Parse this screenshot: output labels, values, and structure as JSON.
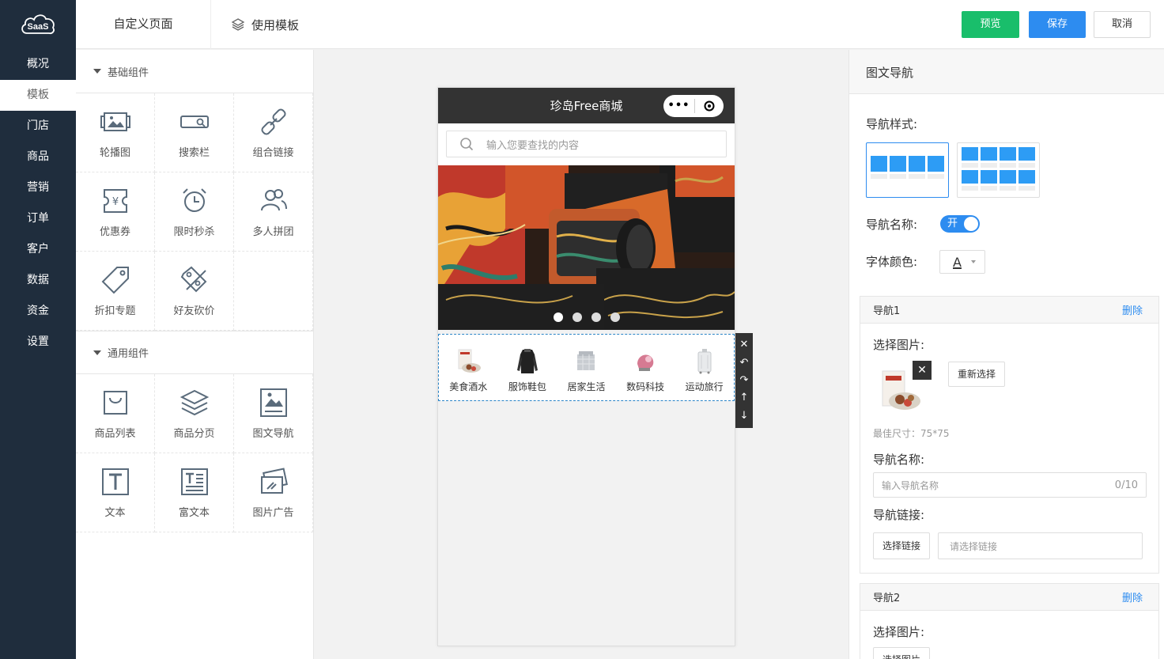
{
  "app": {
    "logo_text": "SaaS"
  },
  "leftnav": {
    "items": [
      {
        "label": "概况"
      },
      {
        "label": "模板"
      },
      {
        "label": "门店"
      },
      {
        "label": "商品"
      },
      {
        "label": "营销"
      },
      {
        "label": "订单"
      },
      {
        "label": "客户"
      },
      {
        "label": "数据"
      },
      {
        "label": "资金"
      },
      {
        "label": "设置"
      }
    ],
    "active_index": 1
  },
  "header": {
    "tab_custom": "自定义页面",
    "tab_template": "使用模板",
    "preview_label": "预览",
    "save_label": "保存",
    "cancel_label": "取消"
  },
  "components": {
    "basic_title": "基础组件",
    "basic": [
      {
        "label": "轮播图",
        "icon": "carousel-icon"
      },
      {
        "label": "搜索栏",
        "icon": "search-bar-icon"
      },
      {
        "label": "组合链接",
        "icon": "link-icon"
      },
      {
        "label": "优惠券",
        "icon": "coupon-icon"
      },
      {
        "label": "限时秒杀",
        "icon": "alarm-clock-icon"
      },
      {
        "label": "多人拼团",
        "icon": "group-users-icon"
      },
      {
        "label": "折扣专题",
        "icon": "price-tag-icon"
      },
      {
        "label": "好友砍价",
        "icon": "discount-icon"
      }
    ],
    "common_title": "通用组件",
    "common": [
      {
        "label": "商品列表",
        "icon": "shopping-bag-icon"
      },
      {
        "label": "商品分页",
        "icon": "layers-icon"
      },
      {
        "label": "图文导航",
        "icon": "image-nav-icon"
      },
      {
        "label": "文本",
        "icon": "text-icon"
      },
      {
        "label": "富文本",
        "icon": "rich-text-icon"
      },
      {
        "label": "图片广告",
        "icon": "image-ad-icon"
      }
    ]
  },
  "phone": {
    "title": "珍岛Free商城",
    "search_placeholder": "输入您要查找的内容",
    "banner_dots": 4,
    "banner_active_dot": 0,
    "nav_items": [
      {
        "label": "美食酒水"
      },
      {
        "label": "服饰鞋包"
      },
      {
        "label": "居家生活"
      },
      {
        "label": "数码科技"
      },
      {
        "label": "运动旅行"
      }
    ],
    "toolbar": {
      "close": "✕",
      "undo": "↶",
      "redo": "↷",
      "up": "↑",
      "down": "↓"
    }
  },
  "settings": {
    "title": "图文导航",
    "style_label": "导航样式:",
    "name_label": "导航名称:",
    "toggle_text": "开",
    "font_color_label": "字体颜色:",
    "font_color_glyph": "A",
    "nav1": {
      "title": "导航1",
      "delete": "删除",
      "select_image": "选择图片:",
      "reselect": "重新选择",
      "best_size": "最佳尺寸：75*75",
      "name_label": "导航名称:",
      "name_placeholder": "输入导航名称",
      "name_count": "0/10",
      "link_label": "导航链接:",
      "link_button": "选择链接",
      "link_placeholder": "请选择链接"
    },
    "nav2": {
      "title": "导航2",
      "delete": "删除",
      "select_image": "选择图片:",
      "select_button": "选择图片"
    }
  },
  "colors": {
    "sidebar": "#1f2d3d",
    "green": "#19be6b",
    "blue": "#2d8cf0",
    "nav_block": "#2d9cf5"
  }
}
